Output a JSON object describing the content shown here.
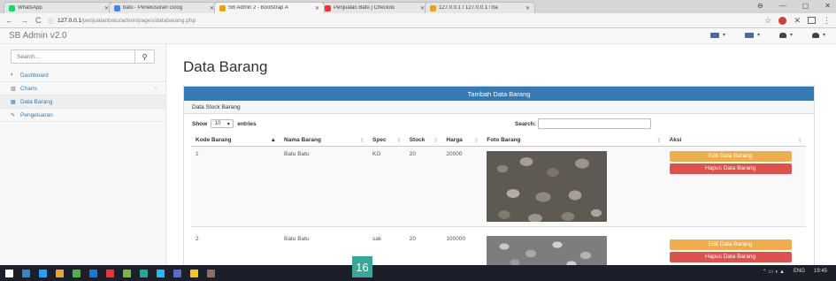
{
  "browser": {
    "tabs": [
      {
        "title": "WhatsApp",
        "color": "#25d366"
      },
      {
        "title": "batu - Penelusuran Goog",
        "color": "#4285f4"
      },
      {
        "title": "SB Admin 2 - Bootstrap A",
        "color": "#f0a020"
      },
      {
        "title": "Penjualan Batu | Checkou",
        "color": "#e53935"
      },
      {
        "title": "127.0.0.1 / 127.0.0.1 / ba",
        "color": "#f0a020"
      }
    ],
    "address": {
      "host": "127.0.0.1",
      "path": "/penjualanbatu/admin/pages/databarang.php"
    }
  },
  "navbar": {
    "brand": "SB Admin v2.0"
  },
  "sidebar": {
    "search_placeholder": "Search...",
    "items": [
      {
        "label": "Dashboard",
        "icon": "dashboard-icon"
      },
      {
        "label": "Charts",
        "icon": "chart-icon"
      },
      {
        "label": "Data Barang",
        "icon": "table-icon"
      },
      {
        "label": "Pengeluaran",
        "icon": "edit-icon"
      }
    ]
  },
  "page": {
    "title": "Data Barang",
    "panel_header": "Tambah Data Barang",
    "sub_header": "Data Stock Barang",
    "show_label": "Show",
    "entries_value": "10",
    "entries_label": "entries",
    "search_label": "Search:",
    "columns": [
      "Kode Barang",
      "Nama Barang",
      "Spec",
      "Stock",
      "Harga",
      "Foto Barang",
      "Aksi"
    ],
    "rows": [
      {
        "kode": "1",
        "nama": "Batu Batu",
        "spec": "KG",
        "stock": "20",
        "harga": "20000",
        "foto": "river-stones"
      },
      {
        "kode": "2",
        "nama": "Batu Batu",
        "spec": "sak",
        "stock": "20",
        "harga": "100000",
        "foto": "gravel"
      }
    ],
    "edit_label": "Edit Data Barang",
    "delete_label": "Hapus Data Barang"
  },
  "taskbar": {
    "badge": "16",
    "lang": "ENG",
    "time": "19:45"
  }
}
